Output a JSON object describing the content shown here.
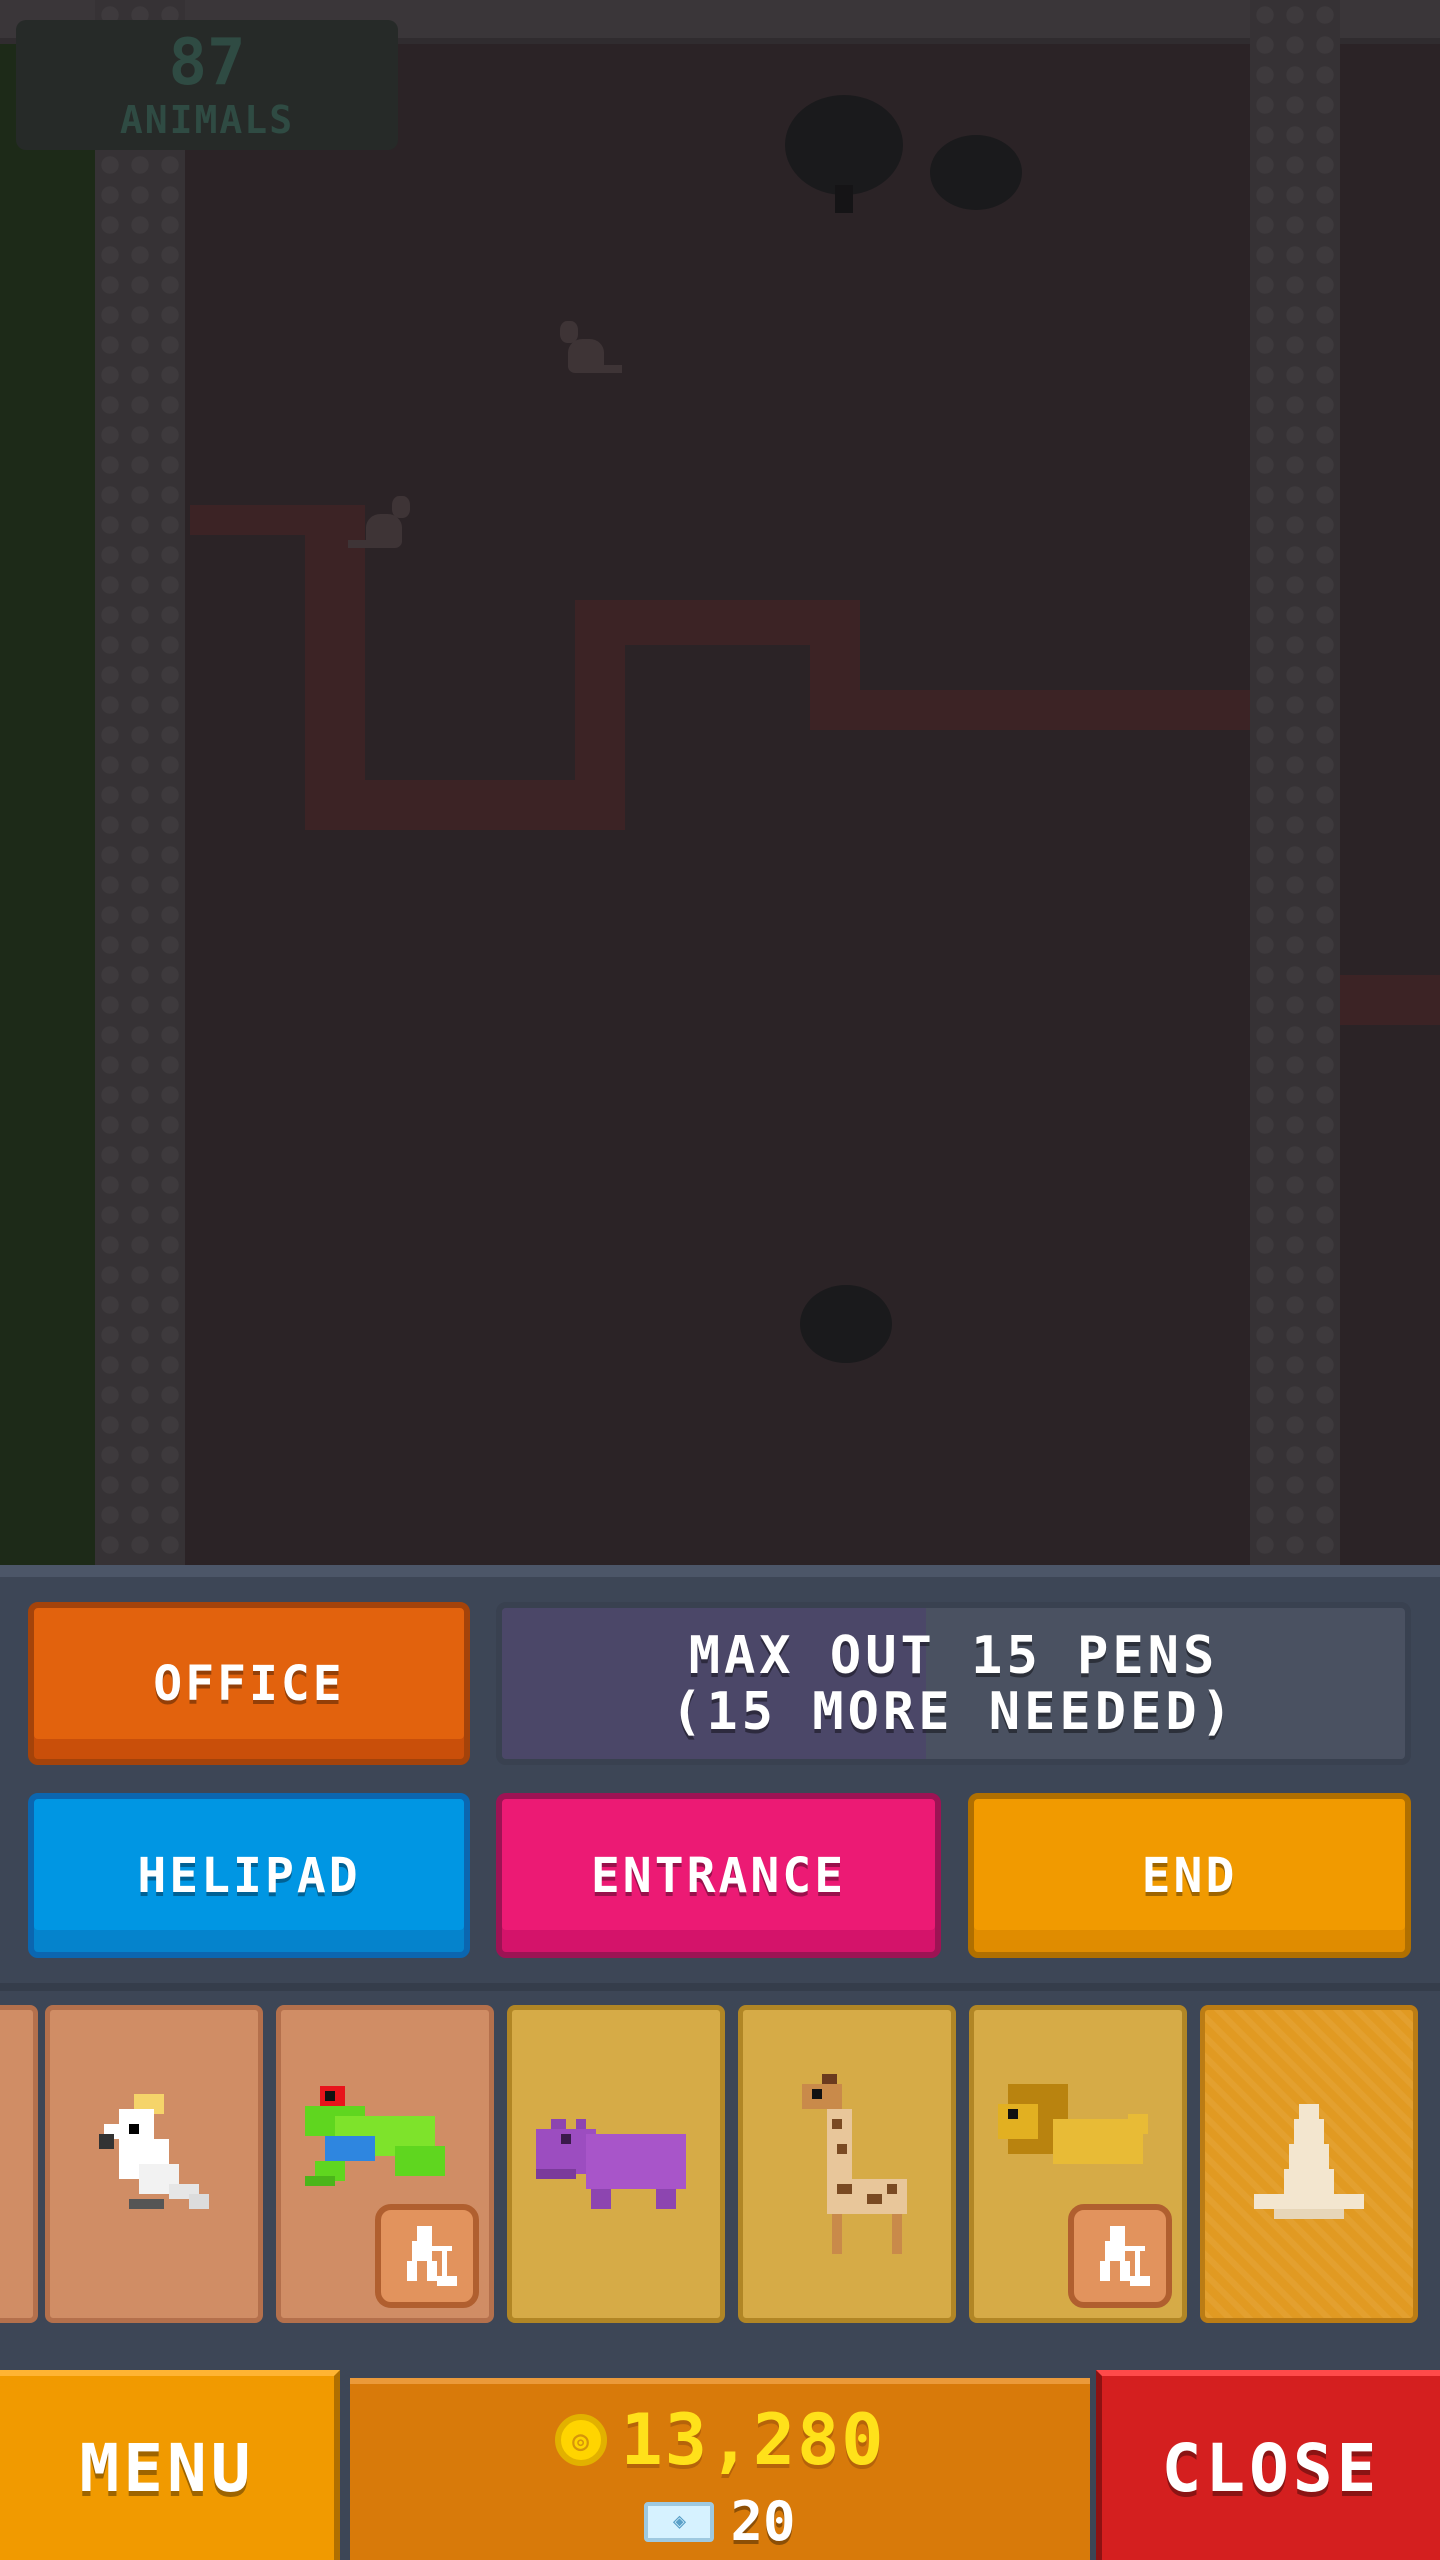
{
  "counter": {
    "value": "87",
    "label": "ANIMALS"
  },
  "actions": {
    "office": "OFFICE",
    "goal_line1": "MAX OUT 15 PENS",
    "goal_line2": "(15 MORE NEEDED)",
    "helipad": "HELIPAD",
    "entrance": "ENTRANCE",
    "end": "END"
  },
  "cards": [
    {
      "animal": "cockatoo",
      "state": "available"
    },
    {
      "animal": "frog",
      "state": "under-construction"
    },
    {
      "animal": "hippo",
      "state": "available"
    },
    {
      "animal": "giraffe",
      "state": "available"
    },
    {
      "animal": "lion",
      "state": "under-construction"
    },
    {
      "animal": "cone",
      "state": "build"
    }
  ],
  "bottom": {
    "menu": "MENU",
    "coins": "13,280",
    "tickets": "20",
    "close": "CLOSE"
  },
  "colors": {
    "office": "#e2620d",
    "helipad": "#0096e3",
    "entrance": "#ec1a74",
    "end": "#f19a00",
    "close": "#d41f1f",
    "coins": "#ffe11a"
  }
}
